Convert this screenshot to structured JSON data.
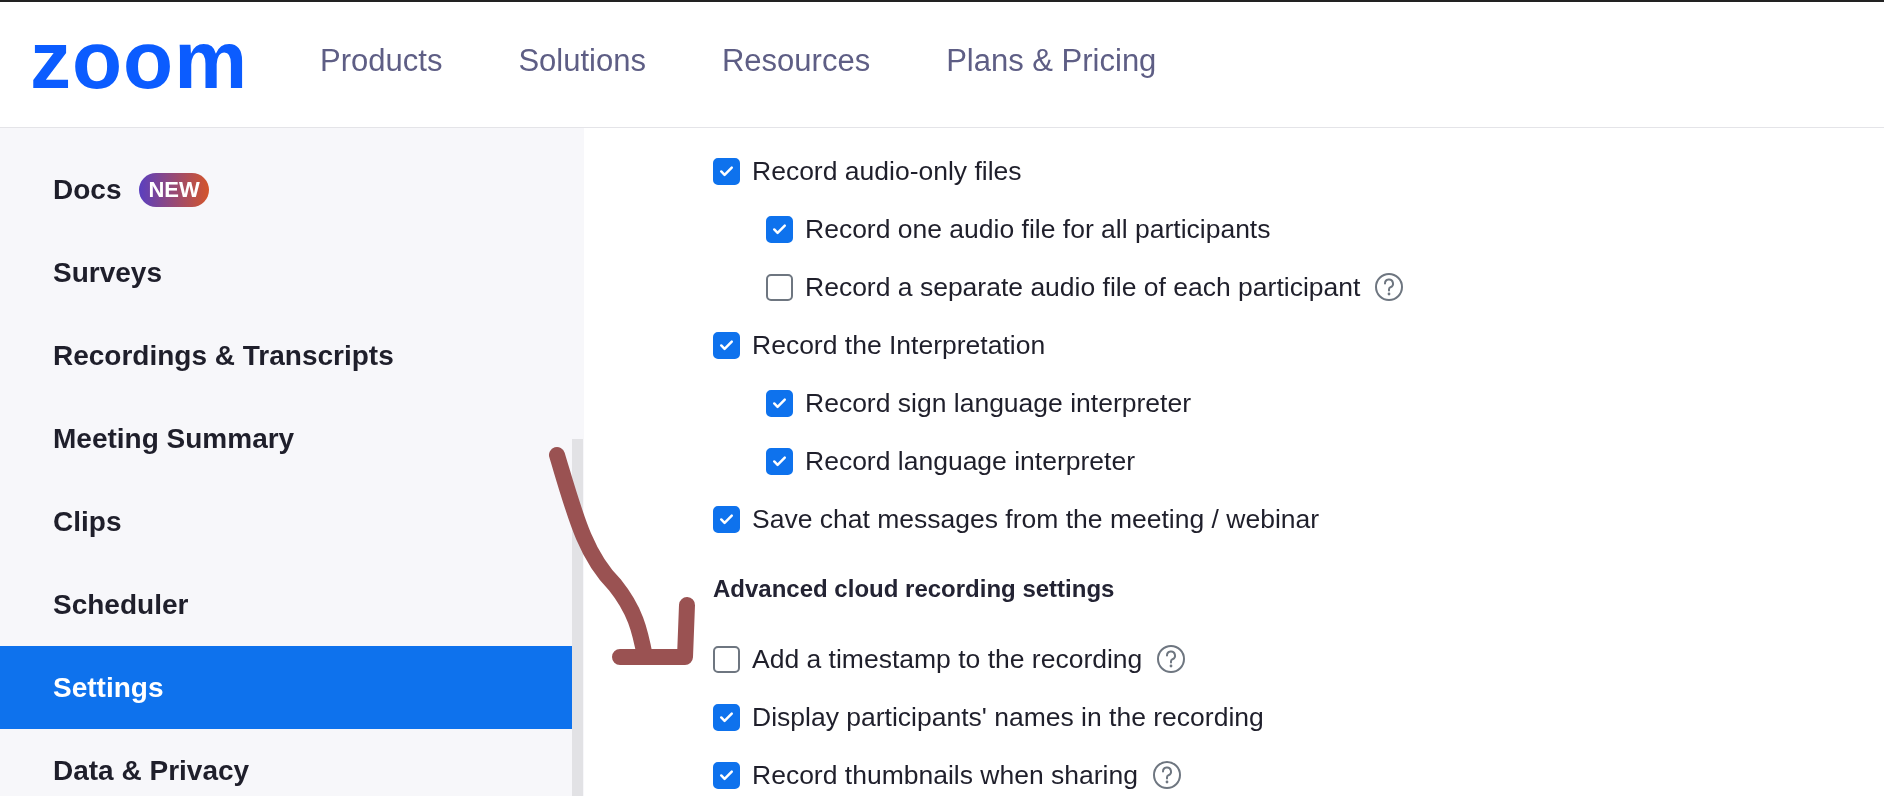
{
  "header": {
    "logo": "zoom",
    "nav": [
      "Products",
      "Solutions",
      "Resources",
      "Plans & Pricing"
    ]
  },
  "sidebar": {
    "items": [
      {
        "label": "Docs",
        "badge": "NEW",
        "selected": false
      },
      {
        "label": "Surveys",
        "selected": false
      },
      {
        "label": "Recordings & Transcripts",
        "selected": false
      },
      {
        "label": "Meeting Summary",
        "selected": false
      },
      {
        "label": "Clips",
        "selected": false
      },
      {
        "label": "Scheduler",
        "selected": false
      },
      {
        "label": "Settings",
        "selected": true
      },
      {
        "label": "Data & Privacy",
        "selected": false
      }
    ]
  },
  "settings": [
    {
      "kind": "checkbox",
      "label": "Record audio-only files",
      "checked": true,
      "children": [
        {
          "label": "Record one audio file for all participants",
          "checked": true
        },
        {
          "label": "Record a separate audio file of each participant",
          "checked": false,
          "help": true
        }
      ]
    },
    {
      "kind": "checkbox",
      "label": "Record the Interpretation",
      "checked": true,
      "children": [
        {
          "label": "Record sign language interpreter",
          "checked": true
        },
        {
          "label": "Record language interpreter",
          "checked": true
        }
      ]
    },
    {
      "kind": "checkbox",
      "label": "Save chat messages from the meeting / webinar",
      "checked": true
    },
    {
      "kind": "heading",
      "label": "Advanced cloud recording settings"
    },
    {
      "kind": "checkbox",
      "label": "Add a timestamp to the recording",
      "checked": false,
      "help": true
    },
    {
      "kind": "checkbox",
      "label": "Display participants' names in the recording",
      "checked": true
    },
    {
      "kind": "checkbox",
      "label": "Record thumbnails when sharing",
      "checked": true,
      "help": true
    }
  ]
}
